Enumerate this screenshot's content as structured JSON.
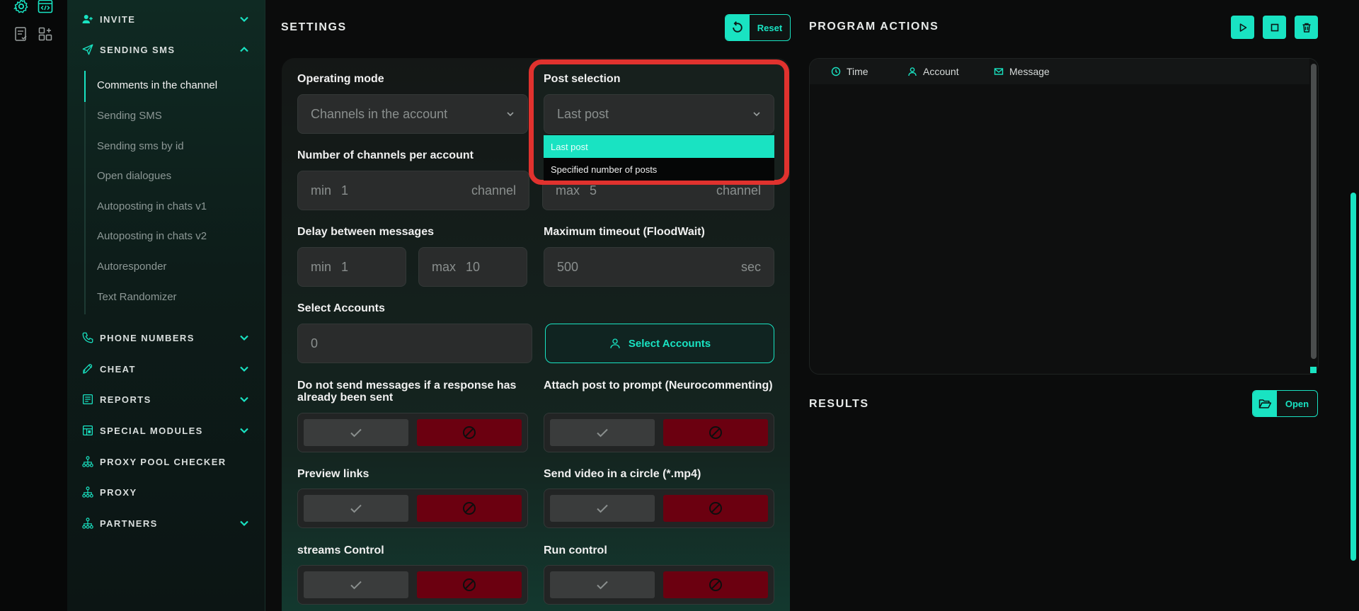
{
  "colors": {
    "accent": "#19e3c2",
    "danger": "#6b0010",
    "highlight": "#e0322e"
  },
  "rail": {
    "icons": [
      "gear-icon",
      "code-icon",
      "notes-check-icon",
      "grid-icon"
    ]
  },
  "sidebar": {
    "sections_top": [
      {
        "label": "INVITE",
        "icon": "user-plus-icon",
        "expanded": false
      },
      {
        "label": "SENDING SMS",
        "icon": "send-icon",
        "expanded": true
      }
    ],
    "sub_items": [
      "Comments in the channel",
      "Sending SMS",
      "Sending sms by id",
      "Open dialogues",
      "Autoposting in chats v1",
      "Autoposting in chats v2",
      "Autoresponder",
      "Text Randomizer"
    ],
    "active_sub": "Comments in the channel",
    "sections_bottom": [
      {
        "label": "PHONE NUMBERS",
        "icon": "phone-icon",
        "has_chevron": true
      },
      {
        "label": "CHEAT",
        "icon": "rocket-icon",
        "has_chevron": true
      },
      {
        "label": "REPORTS",
        "icon": "report-icon",
        "has_chevron": true
      },
      {
        "label": "SPECIAL MODULES",
        "icon": "modules-icon",
        "has_chevron": true
      },
      {
        "label": "PROXY POOL CHECKER",
        "icon": "network-icon",
        "has_chevron": false
      },
      {
        "label": "PROXY",
        "icon": "network-icon",
        "has_chevron": false
      },
      {
        "label": "PARTNERS",
        "icon": "network-icon",
        "has_chevron": true
      }
    ]
  },
  "settings": {
    "title": "SETTINGS",
    "reset_label": "Reset",
    "operating_mode": {
      "label": "Operating mode",
      "value": "Channels in the account"
    },
    "post_selection": {
      "label": "Post selection",
      "value": "Last post",
      "options": [
        "Last post",
        "Specified number of posts"
      ],
      "selected_index": 0
    },
    "channels_per_account": {
      "label": "Number of channels per account",
      "min_prefix": "min",
      "min_value": "1",
      "min_suffix": "channel",
      "max_prefix": "max",
      "max_value": "5",
      "max_suffix": "channel"
    },
    "delay": {
      "label": "Delay between messages",
      "min_prefix": "min",
      "min_value": "1",
      "max_prefix": "max",
      "max_value": "10"
    },
    "timeout": {
      "label": "Maximum timeout (FloodWait)",
      "value": "500",
      "suffix": "sec"
    },
    "select_accounts": {
      "label": "Select Accounts",
      "value": "0",
      "button_label": "Select Accounts"
    },
    "toggles": [
      {
        "label": "Do not send messages if a response has already been sent"
      },
      {
        "label": "Attach post to prompt (Neurocommenting)"
      },
      {
        "label": "Preview links"
      },
      {
        "label": "Send video in a circle (*.mp4)"
      },
      {
        "label": "streams Control"
      },
      {
        "label": "Run control"
      }
    ]
  },
  "program_actions": {
    "title": "PROGRAM ACTIONS",
    "buttons": [
      "play-icon",
      "stop-icon",
      "trash-icon"
    ],
    "columns": [
      "Time",
      "Account",
      "Message"
    ]
  },
  "results": {
    "title": "RESULTS",
    "open_label": "Open"
  }
}
